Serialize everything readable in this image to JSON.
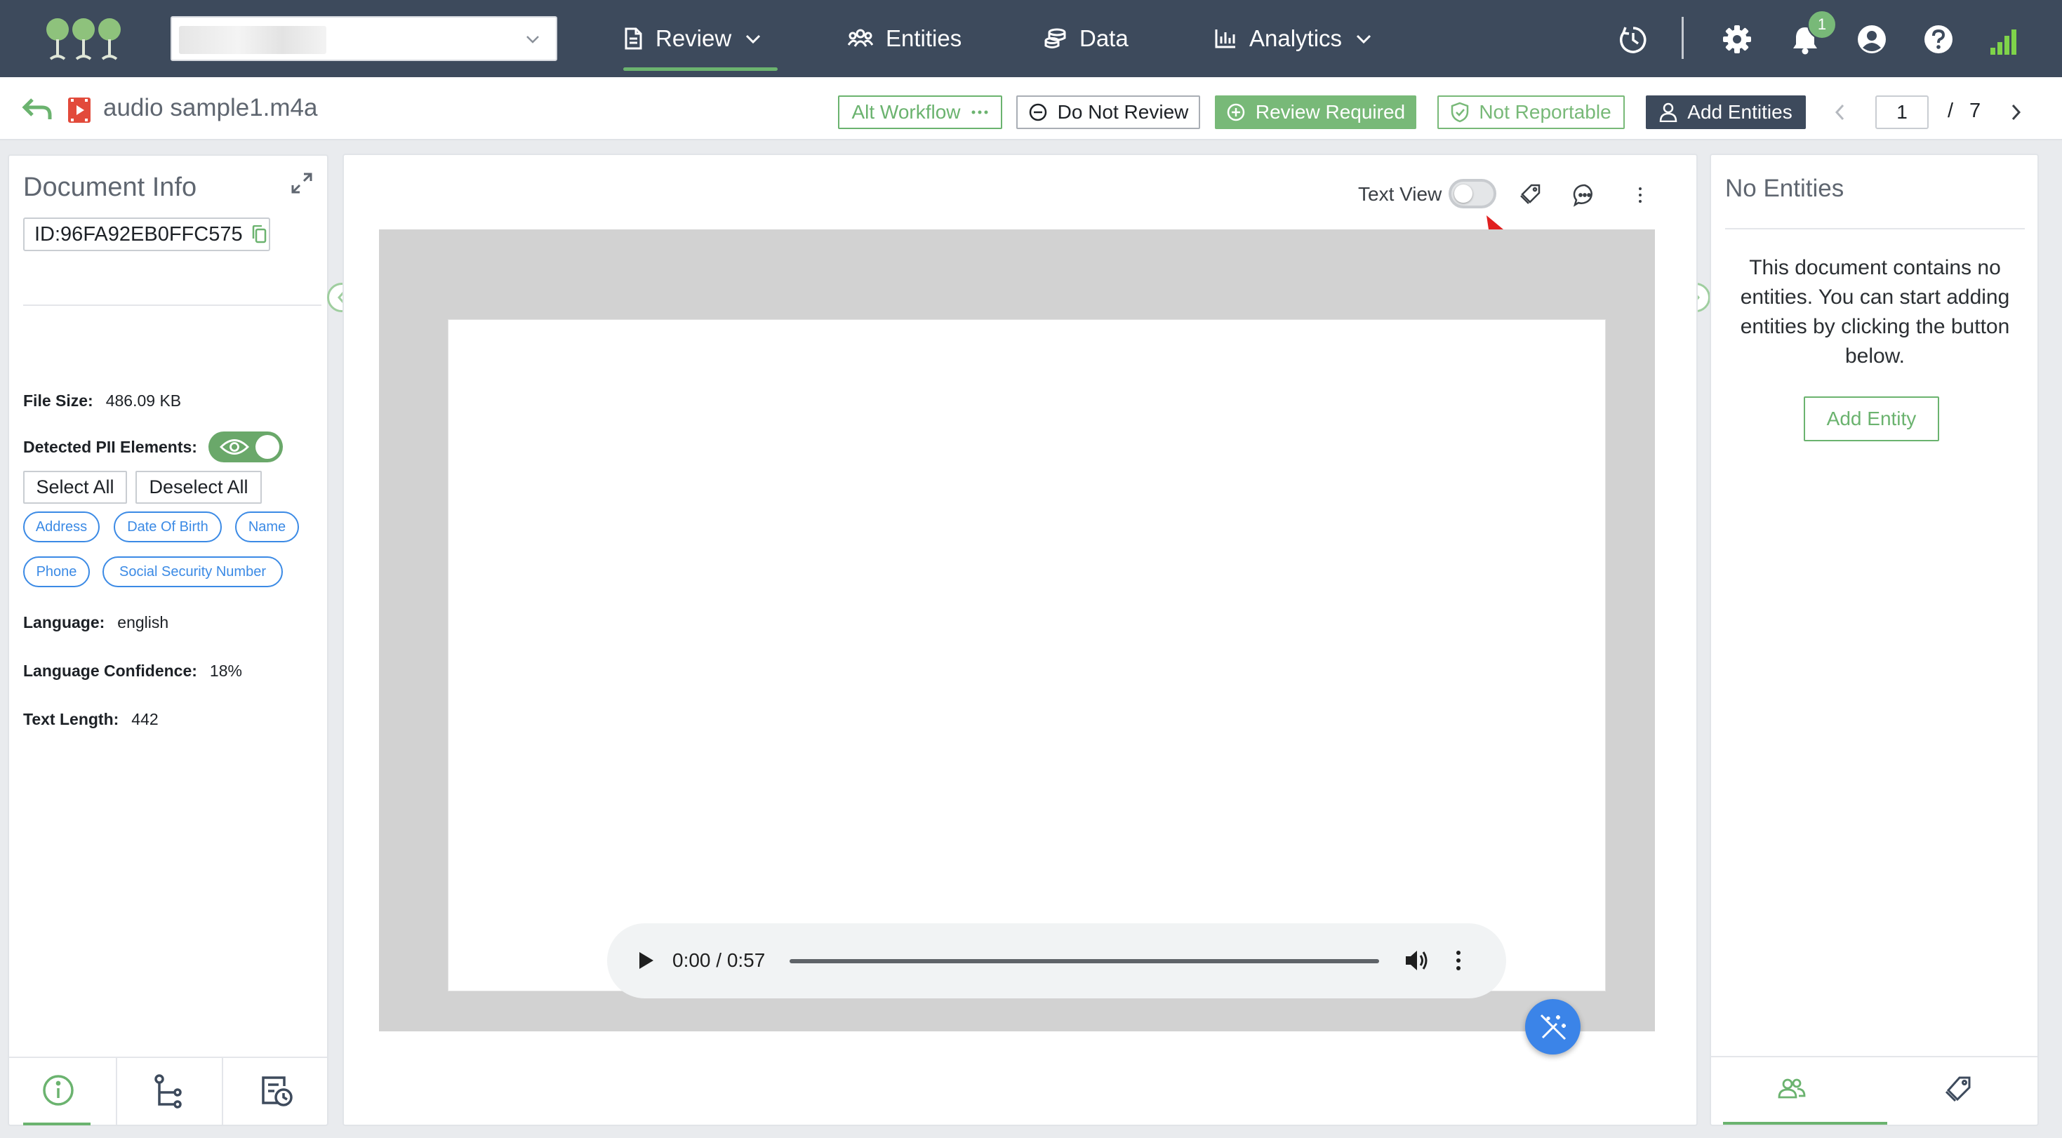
{
  "nav": {
    "workspace_value": "",
    "items": [
      {
        "label": "Review",
        "icon": "document-icon",
        "active": true
      },
      {
        "label": "Entities",
        "icon": "people-group-icon"
      },
      {
        "label": "Data",
        "icon": "database-icon"
      },
      {
        "label": "Analytics",
        "icon": "bar-chart-icon"
      }
    ],
    "notification_count": "1",
    "colors": {
      "bg": "#3d4a5c",
      "accent": "#6bb36f",
      "badge": "#78b978",
      "signal": "#7fd34a"
    }
  },
  "subheader": {
    "filename": "audio sample1.m4a",
    "buttons": {
      "alt_workflow": "Alt Workflow",
      "do_not_review": "Do Not Review",
      "review_required": "Review Required",
      "not_reportable": "Not Reportable",
      "add_entities": "Add Entities"
    },
    "pagination": {
      "current": "1",
      "separator": "/",
      "total": "7"
    }
  },
  "doc_info": {
    "title": "Document Info",
    "id": "ID:96FA92EB0FFC575",
    "file_size_label": "File Size:",
    "file_size_value": "486.09 KB",
    "pii_label": "Detected PII Elements:",
    "pii_visible": true,
    "select_all": "Select All",
    "deselect_all": "Deselect All",
    "pii_tags": [
      "Address",
      "Date Of Birth",
      "Name",
      "Phone",
      "Social Security Number"
    ],
    "language_label": "Language:",
    "language_value": "english",
    "confidence_label": "Language Confidence:",
    "confidence_value": "18%",
    "text_length_label": "Text Length:",
    "text_length_value": "442",
    "tabs": [
      "info-icon",
      "workflow-tree-icon",
      "history-icon"
    ]
  },
  "viewer": {
    "text_view_label": "Text View",
    "text_view_on": false,
    "audio": {
      "time": "0:00 / 0:57",
      "progress": 0
    }
  },
  "entities": {
    "title": "No Entities",
    "message": "This document contains no entities. You can start adding entities by clicking the button below.",
    "add_button": "Add Entity",
    "tabs": [
      "people-icon",
      "tag-icon"
    ]
  }
}
